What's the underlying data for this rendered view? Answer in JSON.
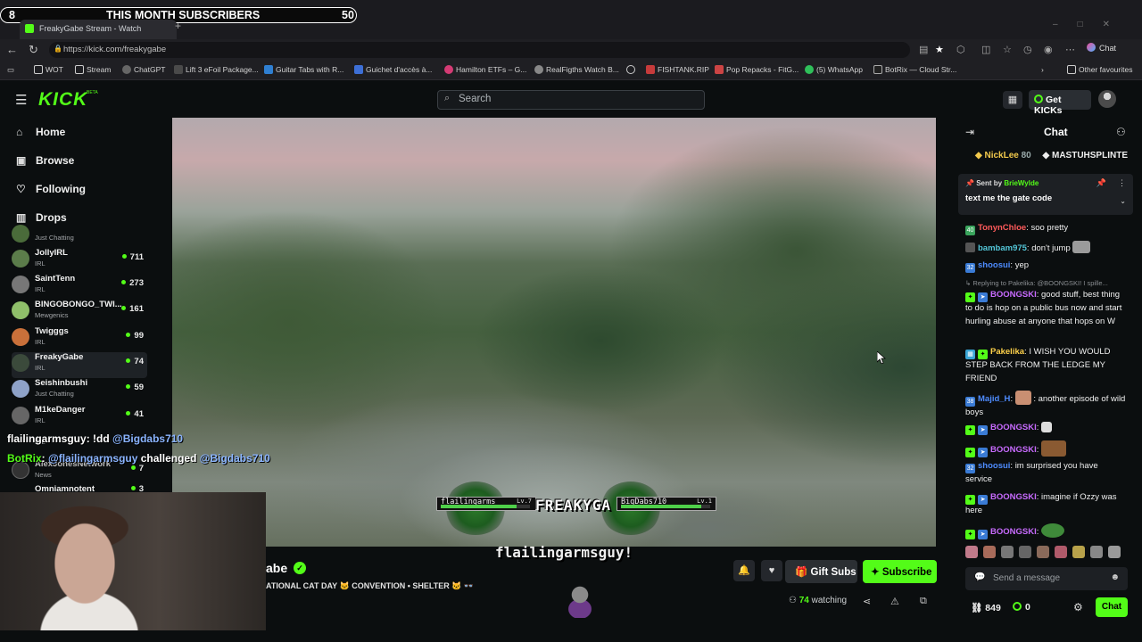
{
  "overlay": {
    "sub_count_left": "8",
    "sub_label": "THIS MONTH SUBSCRIBERS",
    "sub_goal": "50",
    "ticker_line1_user": "flailingarmsguy",
    "ticker_line1_cmd": ": !dd",
    "ticker_line1_mention": "@Bigdabs710",
    "ticker_line2_user": "BotRix",
    "ticker_line2_mention": "@flailingarmsguy",
    "ticker_line2_text": " challenged ",
    "ticker_line2_target": "@Bigdabs710",
    "card_left_name": "flailingarms",
    "card_left_level": "Lv.7",
    "card_left_hp": 0.85,
    "card_right_name": "BigDabs710",
    "card_right_level": "Lv.1",
    "card_right_hp": 0.9,
    "center_text": "FREAKYGA",
    "bottom_text": "flailingarmsguy!"
  },
  "browser": {
    "tab_title": "FreakyGabe Stream - Watch",
    "url": "https://kick.com/freakygabe",
    "chat_button": "Chat",
    "bookmarks": [
      "WOT",
      "Stream",
      "ChatGPT",
      "Lift 3 eFoil Package...",
      "Guitar Tabs with R...",
      "Guichet d'accès à...",
      "Hamilton ETFs – G...",
      "RealFigths Watch B...",
      "FISHTANK.RIP",
      "Pop Repacks - FitG...",
      "(5) WhatsApp",
      "BotRix — Cloud Str..."
    ],
    "other_favourites": "Other favourites"
  },
  "header": {
    "logo": "KICK",
    "beta": "BETA",
    "search_placeholder": "Search",
    "get_kicks": "Get KICKs"
  },
  "sidebar": {
    "nav": [
      {
        "label": "Home",
        "icon": "home-icon"
      },
      {
        "label": "Browse",
        "icon": "browse-icon"
      },
      {
        "label": "Following",
        "icon": "heart-icon"
      },
      {
        "label": "Drops",
        "icon": "drops-icon"
      }
    ],
    "channels": [
      {
        "name": "",
        "category": "Just Chatting",
        "viewers": "",
        "color": "#4a6b3a"
      },
      {
        "name": "JollyIRL",
        "category": "IRL",
        "viewers": "711",
        "color": "#5b7c4a"
      },
      {
        "name": "SaintTenn",
        "category": "IRL",
        "viewers": "273",
        "color": "#777"
      },
      {
        "name": "BINGOBONGO_TWI...",
        "category": "Mewgenics",
        "viewers": "161",
        "color": "#8fbf6a"
      },
      {
        "name": "Twigggs",
        "category": "IRL",
        "viewers": "99",
        "color": "#c9703a"
      },
      {
        "name": "FreakyGabe",
        "category": "IRL",
        "viewers": "74",
        "color": "#3b4a3b"
      },
      {
        "name": "Seishinbushi",
        "category": "Just Chatting",
        "viewers": "59",
        "color": "#8ea2c8"
      },
      {
        "name": "M1keDanger",
        "category": "IRL",
        "viewers": "41",
        "color": "#666"
      },
      {
        "name": "",
        "category": "IRL",
        "viewers": "",
        "color": "#555"
      },
      {
        "name": "AlexJonesNetwork",
        "category": "News",
        "viewers": "7",
        "color": "#333"
      },
      {
        "name": "Omniamnotent",
        "category": "",
        "viewers": "3",
        "color": "#444"
      }
    ]
  },
  "stream": {
    "name": "abe",
    "title": "ATIONAL CAT DAY 🐱 CONVENTION • SHELTER 🐱 👓",
    "gift_subs": "Gift Subs",
    "subscribe": "Subscribe",
    "watching_count": "74",
    "watching_label": " watching"
  },
  "chat": {
    "title": "Chat",
    "top_gifters": [
      {
        "name": "NickLee",
        "count": "80"
      },
      {
        "name": "MASTUHSPLINTE",
        "count": ""
      }
    ],
    "pinned_by_label": "Sent by",
    "pinned_by": "BrieWylde",
    "pinned_message": "text me the gate code",
    "messages": [
      {
        "user": "TonynChloe",
        "color": "#ff5b5b",
        "text": ": soo pretty",
        "badge": "#3aa55d",
        "badge_text": "40"
      },
      {
        "user": "bambam975",
        "color": "#53c6d8",
        "text": ": don't jump",
        "badge": "#555",
        "badge_text": ""
      },
      {
        "user": "shoosui",
        "color": "#4e8cff",
        "text": ": yep",
        "badge": "#3a7bd5",
        "badge_text": "32"
      },
      {
        "user": "BOONGSKI",
        "color": "#c86bff",
        "text": ": good stuff, best thing to do is hop on a public bus now and start hurling abuse at anyone that hops on W",
        "badge": "#53fc18",
        "badge_text": ""
      },
      {
        "user": "Pakelika",
        "color": "#ffd24a",
        "text": ": I WISH YOU WOULD STEP BACK FROM THE LEDGE MY FRIEND",
        "badge": "#3aa5d5",
        "badge_text": ""
      },
      {
        "user": "Majid_H",
        "color": "#4e8cff",
        "text": ": another episode of wild boys",
        "badge": "#3a7bd5",
        "badge_text": "38"
      },
      {
        "user": "BOONGSKI",
        "color": "#c86bff",
        "text": ":",
        "badge": "#53fc18",
        "badge_text": ""
      },
      {
        "user": "BOONGSKI",
        "color": "#c86bff",
        "text": ":",
        "badge": "#53fc18",
        "badge_text": ""
      },
      {
        "user": "shoosui",
        "color": "#4e8cff",
        "text": ": im surprised you have service",
        "badge": "#3a7bd5",
        "badge_text": "32"
      },
      {
        "user": "BOONGSKI",
        "color": "#c86bff",
        "text": ": imagine if Ozzy was here",
        "badge": "#53fc18",
        "badge_text": ""
      },
      {
        "user": "BOONGSKI",
        "color": "#c86bff",
        "text": ":",
        "badge": "#53fc18",
        "badge_text": ""
      }
    ],
    "reply_label": "Replying to Pakelika: @BOONGSKI! I spille...",
    "send_placeholder": "Send a message",
    "points": "849",
    "kicks": "0",
    "send_button": "Chat"
  }
}
